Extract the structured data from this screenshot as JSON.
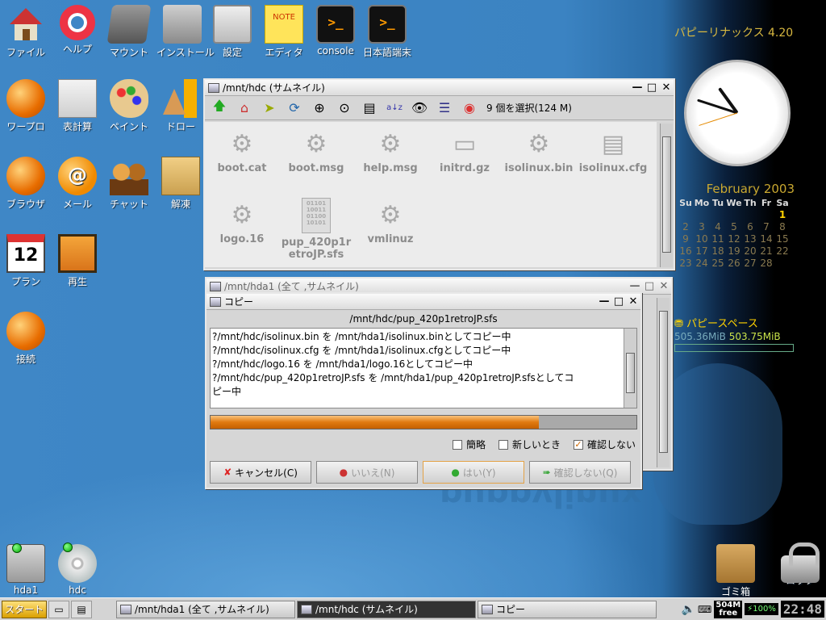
{
  "desktop": {
    "icons_top": [
      {
        "label": "ファイル",
        "icon": "home-icon"
      },
      {
        "label": "ヘルプ",
        "icon": "lifebuoy-icon"
      },
      {
        "label": "マウント",
        "icon": "harddisk-icon"
      },
      {
        "label": "インストール",
        "icon": "package-icon"
      },
      {
        "label": "設定",
        "icon": "settings-icon"
      },
      {
        "label": "エディタ",
        "icon": "note-icon",
        "glyph": "NOTE"
      },
      {
        "label": "console",
        "icon": "terminal-icon",
        "glyph": ">_"
      },
      {
        "label": "日本語端末",
        "icon": "terminal-icon",
        "glyph": ">_"
      }
    ],
    "icons_left": [
      {
        "label": "ワープロ",
        "icon": "wordprocessor-icon"
      },
      {
        "label": "表計算",
        "icon": "spreadsheet-icon"
      },
      {
        "label": "ペイント",
        "icon": "paint-palette-icon"
      },
      {
        "label": "ドロー",
        "icon": "draw-shapes-icon"
      },
      {
        "label": "ブラウザ",
        "icon": "browser-globe-icon"
      },
      {
        "label": "メール",
        "icon": "mail-icon",
        "glyph": "@"
      },
      {
        "label": "チャット",
        "icon": "chat-people-icon"
      },
      {
        "label": "解凍",
        "icon": "archive-icon"
      },
      {
        "label": "プラン",
        "icon": "calendar-icon",
        "glyph": "12"
      },
      {
        "label": "再生",
        "icon": "media-player-icon"
      },
      {
        "label": "接続",
        "icon": "connect-globe-icon"
      }
    ],
    "icons_bottom": [
      {
        "label": "hda1",
        "icon": "drive-icon"
      },
      {
        "label": "hdc",
        "icon": "cdrom-icon"
      },
      {
        "label": "ゴミ箱",
        "icon": "trash-icon"
      },
      {
        "label": "ロック",
        "icon": "lock-icon"
      }
    ],
    "wallpaper_text": "puppylinux"
  },
  "widgets": {
    "brand": "パピーリナックス 4.20",
    "clock": {
      "hours": 22,
      "minutes": 48
    },
    "calendar": {
      "title": "February 2003",
      "weekdays": [
        "Su",
        "Mo",
        "Tu",
        "We",
        "Th",
        "Fr",
        "Sa"
      ],
      "days": [
        "",
        "",
        "",
        "",
        "",
        "",
        "1",
        "2",
        "3",
        "4",
        "5",
        "6",
        "7",
        "8",
        "9",
        "10",
        "11",
        "12",
        "13",
        "14",
        "15",
        "16",
        "17",
        "18",
        "19",
        "20",
        "21",
        "22",
        "23",
        "24",
        "25",
        "26",
        "27",
        "28"
      ],
      "today": "1"
    },
    "space": {
      "title": "パピースペース",
      "used": "505.36MiB",
      "free": "503.75MiB",
      "fill_fraction": 0.0
    }
  },
  "file_window": {
    "title": "/mnt/hdc (サムネイル)",
    "status": "9 個を選択(124 M)",
    "toolbar_icons": [
      "up-arrow-icon",
      "home-icon",
      "goto-icon",
      "refresh-icon",
      "zoom-in-icon",
      "zoom-fit-icon",
      "details-view-icon",
      "sort-az-icon",
      "show-hidden-icon",
      "list-view-icon",
      "help-icon"
    ],
    "files": [
      {
        "name": "boot.cat",
        "icon": "gear-file-icon"
      },
      {
        "name": "boot.msg",
        "icon": "gear-file-icon"
      },
      {
        "name": "help.msg",
        "icon": "gear-file-icon"
      },
      {
        "name": "initrd.gz",
        "icon": "archive-file-icon"
      },
      {
        "name": "isolinux.bin",
        "icon": "gear-file-icon"
      },
      {
        "name": "isolinux.cfg",
        "icon": "text-file-icon"
      },
      {
        "name": "logo.16",
        "icon": "gear-file-icon"
      },
      {
        "name": "pup_420p1retroJP.sfs",
        "display": [
          "pup_420p1r",
          "etroJP.sfs"
        ],
        "icon": "binary-file-icon",
        "glyph": "01101\n10011\n01100\n10101"
      },
      {
        "name": "vmlinuz",
        "icon": "gear-file-icon"
      }
    ]
  },
  "hda1_window": {
    "title": "/mnt/hda1 (全て ,サムネイル)"
  },
  "copy_dialog": {
    "title": "コピー",
    "current_file": "/mnt/hdc/pup_420p1retroJP.sfs",
    "log": [
      "?/mnt/hdc/isolinux.bin を /mnt/hda1/isolinux.binとしてコピー中",
      "?/mnt/hdc/isolinux.cfg を /mnt/hda1/isolinux.cfgとしてコピー中",
      "?/mnt/hdc/logo.16 を /mnt/hda1/logo.16としてコピー中",
      "?/mnt/hdc/pup_420p1retroJP.sfs を /mnt/hda1/pup_420p1retroJP.sfsとしてコ",
      "ピー中"
    ],
    "progress": 0.77,
    "options": [
      {
        "label": "簡略",
        "checked": false
      },
      {
        "label": "新しいとき",
        "checked": false
      },
      {
        "label": "確認しない",
        "checked": true
      }
    ],
    "buttons": {
      "cancel": "キャンセル(C)",
      "no": "いいえ(N)",
      "yes": "はい(Y)",
      "no_confirm": "確認しない(Q)"
    }
  },
  "taskbar": {
    "start": "スタート",
    "tasks": [
      {
        "label": "/mnt/hda1 (全て ,サムネイル)",
        "active": false
      },
      {
        "label": "/mnt/hdc (サムネイル)",
        "active": true
      },
      {
        "label": "コピー",
        "active": false
      }
    ],
    "mem": [
      "504M",
      "free"
    ],
    "battery": "100%",
    "time": "22:48"
  },
  "colors": {
    "accent_orange": "#e07a10",
    "calendar_gold": "#c9a830",
    "desktop_blue": "#3f87c6"
  }
}
